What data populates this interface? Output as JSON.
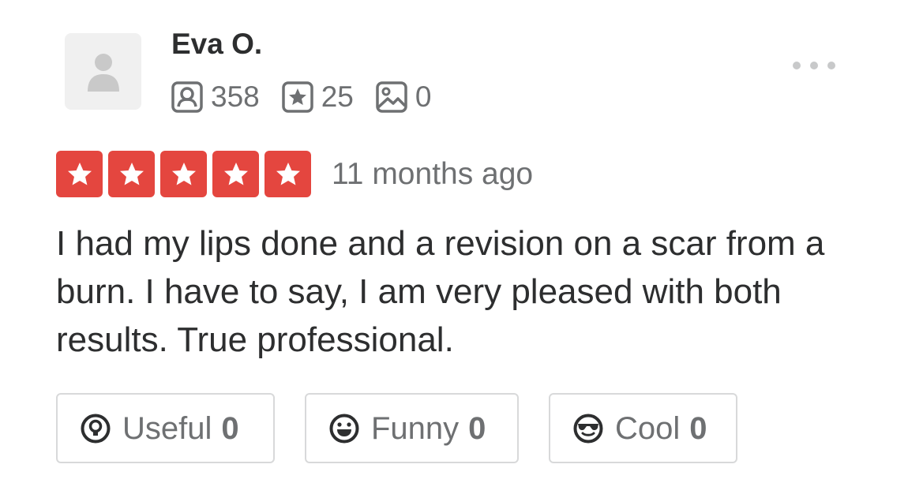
{
  "user": {
    "name": "Eva O.",
    "avatar_icon": "person-silhouette-icon",
    "stats": [
      {
        "icon": "friends-icon",
        "value": "358"
      },
      {
        "icon": "reviews-star-icon",
        "value": "25"
      },
      {
        "icon": "photos-icon",
        "value": "0"
      }
    ]
  },
  "menu": {
    "icon": "more-options-icon"
  },
  "rating": {
    "stars": 5,
    "max_stars": 5,
    "color": "#e4463f",
    "timestamp": "11 months ago"
  },
  "review": {
    "text": "I had my lips done and a revision on a scar from a burn. I have to say, I am very pleased with both results. True professional."
  },
  "reactions": [
    {
      "label": "Useful",
      "count": "0",
      "icon": "lightbulb-icon"
    },
    {
      "label": "Funny",
      "count": "0",
      "icon": "smiley-icon"
    },
    {
      "label": "Cool",
      "count": "0",
      "icon": "sunglasses-icon"
    }
  ]
}
